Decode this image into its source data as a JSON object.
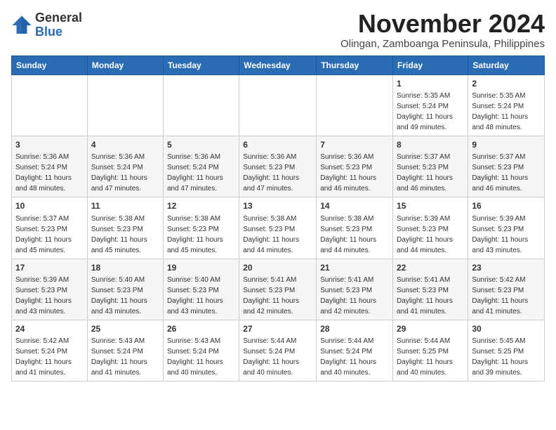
{
  "logo": {
    "general": "General",
    "blue": "Blue"
  },
  "header": {
    "month": "November 2024",
    "location": "Olingan, Zamboanga Peninsula, Philippines"
  },
  "weekdays": [
    "Sunday",
    "Monday",
    "Tuesday",
    "Wednesday",
    "Thursday",
    "Friday",
    "Saturday"
  ],
  "weeks": [
    [
      {
        "day": "",
        "info": ""
      },
      {
        "day": "",
        "info": ""
      },
      {
        "day": "",
        "info": ""
      },
      {
        "day": "",
        "info": ""
      },
      {
        "day": "",
        "info": ""
      },
      {
        "day": "1",
        "info": "Sunrise: 5:35 AM\nSunset: 5:24 PM\nDaylight: 11 hours\nand 49 minutes."
      },
      {
        "day": "2",
        "info": "Sunrise: 5:35 AM\nSunset: 5:24 PM\nDaylight: 11 hours\nand 48 minutes."
      }
    ],
    [
      {
        "day": "3",
        "info": "Sunrise: 5:36 AM\nSunset: 5:24 PM\nDaylight: 11 hours\nand 48 minutes."
      },
      {
        "day": "4",
        "info": "Sunrise: 5:36 AM\nSunset: 5:24 PM\nDaylight: 11 hours\nand 47 minutes."
      },
      {
        "day": "5",
        "info": "Sunrise: 5:36 AM\nSunset: 5:24 PM\nDaylight: 11 hours\nand 47 minutes."
      },
      {
        "day": "6",
        "info": "Sunrise: 5:36 AM\nSunset: 5:23 PM\nDaylight: 11 hours\nand 47 minutes."
      },
      {
        "day": "7",
        "info": "Sunrise: 5:36 AM\nSunset: 5:23 PM\nDaylight: 11 hours\nand 46 minutes."
      },
      {
        "day": "8",
        "info": "Sunrise: 5:37 AM\nSunset: 5:23 PM\nDaylight: 11 hours\nand 46 minutes."
      },
      {
        "day": "9",
        "info": "Sunrise: 5:37 AM\nSunset: 5:23 PM\nDaylight: 11 hours\nand 46 minutes."
      }
    ],
    [
      {
        "day": "10",
        "info": "Sunrise: 5:37 AM\nSunset: 5:23 PM\nDaylight: 11 hours\nand 45 minutes."
      },
      {
        "day": "11",
        "info": "Sunrise: 5:38 AM\nSunset: 5:23 PM\nDaylight: 11 hours\nand 45 minutes."
      },
      {
        "day": "12",
        "info": "Sunrise: 5:38 AM\nSunset: 5:23 PM\nDaylight: 11 hours\nand 45 minutes."
      },
      {
        "day": "13",
        "info": "Sunrise: 5:38 AM\nSunset: 5:23 PM\nDaylight: 11 hours\nand 44 minutes."
      },
      {
        "day": "14",
        "info": "Sunrise: 5:38 AM\nSunset: 5:23 PM\nDaylight: 11 hours\nand 44 minutes."
      },
      {
        "day": "15",
        "info": "Sunrise: 5:39 AM\nSunset: 5:23 PM\nDaylight: 11 hours\nand 44 minutes."
      },
      {
        "day": "16",
        "info": "Sunrise: 5:39 AM\nSunset: 5:23 PM\nDaylight: 11 hours\nand 43 minutes."
      }
    ],
    [
      {
        "day": "17",
        "info": "Sunrise: 5:39 AM\nSunset: 5:23 PM\nDaylight: 11 hours\nand 43 minutes."
      },
      {
        "day": "18",
        "info": "Sunrise: 5:40 AM\nSunset: 5:23 PM\nDaylight: 11 hours\nand 43 minutes."
      },
      {
        "day": "19",
        "info": "Sunrise: 5:40 AM\nSunset: 5:23 PM\nDaylight: 11 hours\nand 43 minutes."
      },
      {
        "day": "20",
        "info": "Sunrise: 5:41 AM\nSunset: 5:23 PM\nDaylight: 11 hours\nand 42 minutes."
      },
      {
        "day": "21",
        "info": "Sunrise: 5:41 AM\nSunset: 5:23 PM\nDaylight: 11 hours\nand 42 minutes."
      },
      {
        "day": "22",
        "info": "Sunrise: 5:41 AM\nSunset: 5:23 PM\nDaylight: 11 hours\nand 41 minutes."
      },
      {
        "day": "23",
        "info": "Sunrise: 5:42 AM\nSunset: 5:23 PM\nDaylight: 11 hours\nand 41 minutes."
      }
    ],
    [
      {
        "day": "24",
        "info": "Sunrise: 5:42 AM\nSunset: 5:24 PM\nDaylight: 11 hours\nand 41 minutes."
      },
      {
        "day": "25",
        "info": "Sunrise: 5:43 AM\nSunset: 5:24 PM\nDaylight: 11 hours\nand 41 minutes."
      },
      {
        "day": "26",
        "info": "Sunrise: 5:43 AM\nSunset: 5:24 PM\nDaylight: 11 hours\nand 40 minutes."
      },
      {
        "day": "27",
        "info": "Sunrise: 5:44 AM\nSunset: 5:24 PM\nDaylight: 11 hours\nand 40 minutes."
      },
      {
        "day": "28",
        "info": "Sunrise: 5:44 AM\nSunset: 5:24 PM\nDaylight: 11 hours\nand 40 minutes."
      },
      {
        "day": "29",
        "info": "Sunrise: 5:44 AM\nSunset: 5:25 PM\nDaylight: 11 hours\nand 40 minutes."
      },
      {
        "day": "30",
        "info": "Sunrise: 5:45 AM\nSunset: 5:25 PM\nDaylight: 11 hours\nand 39 minutes."
      }
    ]
  ]
}
